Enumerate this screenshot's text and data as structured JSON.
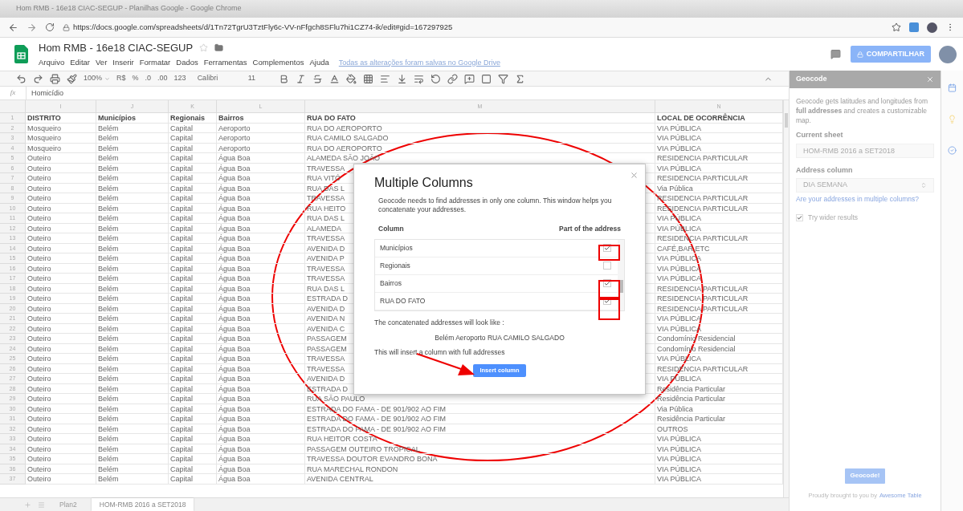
{
  "window": {
    "title": "Hom RMB - 16e18 CIAC-SEGUP - Planilhas Google - Google Chrome"
  },
  "browser": {
    "url": "https://docs.google.com/spreadsheets/d/1Tn72TgrU3TztFly6c-VV-nFfgch8SFlu7hi1CZ74-ik/edit#gid=167297925"
  },
  "document": {
    "title": "Hom RMB - 16e18 CIAC-SEGUP",
    "starred": false,
    "save_status": "Todas as alterações foram salvas no Google Drive",
    "share_button": "COMPARTILHAR"
  },
  "menu": [
    "Arquivo",
    "Editar",
    "Ver",
    "Inserir",
    "Formatar",
    "Dados",
    "Ferramentas",
    "Complementos",
    "Ajuda"
  ],
  "toolbar": {
    "zoom": "100%",
    "currency": "R$",
    "percent": "%",
    "decrease_decimals": ".0",
    "increase_decimals": ".00",
    "number_format": "123",
    "font": "Calibri",
    "font_size": "11"
  },
  "formula_bar": {
    "label": "fx",
    "value": "Homicídio"
  },
  "sheet": {
    "columns": [
      "I",
      "J",
      "K",
      "L",
      "M",
      "N"
    ],
    "header_row": {
      "number": "1",
      "cells": [
        "DISTRITO",
        "Municípios",
        "Regionais",
        "Bairros",
        "RUA DO FATO",
        "LOCAL DE OCORRÊNCIA"
      ]
    },
    "rows": [
      {
        "number": "2",
        "cells": [
          "Mosqueiro",
          "Belém",
          "Capital",
          "Aeroporto",
          "RUA DO AEROPORTO",
          "VIA PÚBLICA"
        ]
      },
      {
        "number": "3",
        "cells": [
          "Mosqueiro",
          "Belém",
          "Capital",
          "Aeroporto",
          "RUA CAMILO SALGADO",
          "VIA PÚBLICA"
        ]
      },
      {
        "number": "4",
        "cells": [
          "Mosqueiro",
          "Belém",
          "Capital",
          "Aeroporto",
          "RUA DO AEROPORTO",
          "VIA PÚBLICA"
        ]
      },
      {
        "number": "5",
        "cells": [
          "Outeiro",
          "Belém",
          "Capital",
          "Água Boa",
          "ALAMEDA SÃO JOÃO",
          "RESIDENCIA PARTICULAR"
        ]
      },
      {
        "number": "6",
        "cells": [
          "Outeiro",
          "Belém",
          "Capital",
          "Água Boa",
          "TRAVESSA",
          "VIA PÚBLICA"
        ]
      },
      {
        "number": "7",
        "cells": [
          "Outeiro",
          "Belém",
          "Capital",
          "Água Boa",
          "RUA VITÓ",
          "RESIDENCIA PARTICULAR"
        ]
      },
      {
        "number": "8",
        "cells": [
          "Outeiro",
          "Belém",
          "Capital",
          "Água Boa",
          "RUA DAS L",
          "Via Pública"
        ]
      },
      {
        "number": "9",
        "cells": [
          "Outeiro",
          "Belém",
          "Capital",
          "Água Boa",
          "TRAVESSA",
          "RESIDENCIA PARTICULAR"
        ]
      },
      {
        "number": "10",
        "cells": [
          "Outeiro",
          "Belém",
          "Capital",
          "Água Boa",
          "RUA HEITO",
          "RESIDENCIA PARTICULAR"
        ]
      },
      {
        "number": "11",
        "cells": [
          "Outeiro",
          "Belém",
          "Capital",
          "Água Boa",
          "RUA DAS L",
          "VIA PÚBLICA"
        ]
      },
      {
        "number": "12",
        "cells": [
          "Outeiro",
          "Belém",
          "Capital",
          "Água Boa",
          "ALAMEDA",
          "VIA PÚBLICA"
        ]
      },
      {
        "number": "13",
        "cells": [
          "Outeiro",
          "Belém",
          "Capital",
          "Água Boa",
          "TRAVESSA",
          "RESIDENCIA PARTICULAR"
        ]
      },
      {
        "number": "14",
        "cells": [
          "Outeiro",
          "Belém",
          "Capital",
          "Água Boa",
          "AVENIDA D",
          "CAFÉ,BAR,ETC"
        ]
      },
      {
        "number": "15",
        "cells": [
          "Outeiro",
          "Belém",
          "Capital",
          "Água Boa",
          "AVENIDA P",
          "VIA PÚBLICA"
        ]
      },
      {
        "number": "16",
        "cells": [
          "Outeiro",
          "Belém",
          "Capital",
          "Água Boa",
          "TRAVESSA",
          "VIA PÚBLICA"
        ]
      },
      {
        "number": "17",
        "cells": [
          "Outeiro",
          "Belém",
          "Capital",
          "Água Boa",
          "TRAVESSA",
          "VIA PÚBLICA"
        ]
      },
      {
        "number": "18",
        "cells": [
          "Outeiro",
          "Belém",
          "Capital",
          "Água Boa",
          "RUA DAS L",
          "RESIDENCIA PARTICULAR"
        ]
      },
      {
        "number": "19",
        "cells": [
          "Outeiro",
          "Belém",
          "Capital",
          "Água Boa",
          "ESTRADA D",
          "RESIDENCIA PARTICULAR"
        ]
      },
      {
        "number": "20",
        "cells": [
          "Outeiro",
          "Belém",
          "Capital",
          "Água Boa",
          "AVENIDA D",
          "RESIDENCIA PARTICULAR"
        ]
      },
      {
        "number": "21",
        "cells": [
          "Outeiro",
          "Belém",
          "Capital",
          "Água Boa",
          "AVENIDA N",
          "VIA PÚBLICA"
        ]
      },
      {
        "number": "22",
        "cells": [
          "Outeiro",
          "Belém",
          "Capital",
          "Água Boa",
          "AVENIDA C",
          "VIA PÚBLICA"
        ]
      },
      {
        "number": "23",
        "cells": [
          "Outeiro",
          "Belém",
          "Capital",
          "Água Boa",
          "PASSAGEM",
          "Condomínio Residencial"
        ]
      },
      {
        "number": "24",
        "cells": [
          "Outeiro",
          "Belém",
          "Capital",
          "Água Boa",
          "PASSAGEM",
          "Condomínio Residencial"
        ]
      },
      {
        "number": "25",
        "cells": [
          "Outeiro",
          "Belém",
          "Capital",
          "Água Boa",
          "TRAVESSA",
          "VIA PÚBLICA"
        ]
      },
      {
        "number": "26",
        "cells": [
          "Outeiro",
          "Belém",
          "Capital",
          "Água Boa",
          "TRAVESSA",
          "RESIDENCIA PARTICULAR"
        ]
      },
      {
        "number": "27",
        "cells": [
          "Outeiro",
          "Belém",
          "Capital",
          "Água Boa",
          "AVENIDA D",
          "VIA PÚBLICA"
        ]
      },
      {
        "number": "28",
        "cells": [
          "Outeiro",
          "Belém",
          "Capital",
          "Água Boa",
          "ESTRADA D",
          "Residência Particular"
        ]
      },
      {
        "number": "29",
        "cells": [
          "Outeiro",
          "Belém",
          "Capital",
          "Água Boa",
          "RUA SÃO PAULO",
          "Residência Particular"
        ]
      },
      {
        "number": "30",
        "cells": [
          "Outeiro",
          "Belém",
          "Capital",
          "Água Boa",
          "ESTRADA DO FAMA - DE 901/902 AO FIM",
          "Via Pública"
        ]
      },
      {
        "number": "31",
        "cells": [
          "Outeiro",
          "Belém",
          "Capital",
          "Água Boa",
          "ESTRADA DO FAMA - DE 901/902 AO FIM",
          "Residência Particular"
        ]
      },
      {
        "number": "32",
        "cells": [
          "Outeiro",
          "Belém",
          "Capital",
          "Água Boa",
          "ESTRADA DO FAMA - DE 901/902 AO FIM",
          "OUTROS"
        ]
      },
      {
        "number": "33",
        "cells": [
          "Outeiro",
          "Belém",
          "Capital",
          "Água Boa",
          "RUA HEITOR COSTA",
          "VIA PÚBLICA"
        ]
      },
      {
        "number": "34",
        "cells": [
          "Outeiro",
          "Belém",
          "Capital",
          "Água Boa",
          "PASSAGEM OUTEIRO TROPICAL",
          "VIA PÚBLICA"
        ]
      },
      {
        "number": "35",
        "cells": [
          "Outeiro",
          "Belém",
          "Capital",
          "Água Boa",
          "TRAVESSA DOUTOR EVANDRO BONA",
          "VIA PÚBLICA"
        ]
      },
      {
        "number": "36",
        "cells": [
          "Outeiro",
          "Belém",
          "Capital",
          "Água Boa",
          "RUA MARECHAL RONDON",
          "VIA PÚBLICA"
        ]
      },
      {
        "number": "37",
        "cells": [
          "Outeiro",
          "Belém",
          "Capital",
          "Água Boa",
          "AVENIDA CENTRAL",
          "VIA PÚBLICA"
        ]
      }
    ]
  },
  "sheet_tabs": [
    {
      "label": "Plan2",
      "selected": false
    },
    {
      "label": "HOM-RMB 2016 a SET2018",
      "selected": true
    }
  ],
  "dialog": {
    "title": "Multiple Columns",
    "description": "Geocode needs to find addresses in only one column. This window helps you concatenate your addresses.",
    "column_header": "Column",
    "part_header": "Part of the address",
    "columns": [
      {
        "label": "Municípios",
        "checked": true
      },
      {
        "label": "Regionais",
        "checked": false
      },
      {
        "label": "Bairros",
        "checked": true
      },
      {
        "label": "RUA DO FATO",
        "checked": true
      }
    ],
    "preview_label": "The concatenated addresses will look like :",
    "preview": "Belém Aeroporto RUA CAMILO SALGADO",
    "note": "This will insert a column with full addresses",
    "button": "Insert column"
  },
  "sidebar": {
    "title": "Geocode",
    "description": "Geocode gets latitudes and longitudes from **full addresses** and creates a customizable map.",
    "current_sheet_label": "Current sheet",
    "current_sheet": "HOM-RMB 2016 a SET2018",
    "address_column_label": "Address column",
    "address_column": "DIA SEMANA",
    "multiple_columns_link": "Are your addresses in multiple columns?",
    "wider_results": {
      "label": "Try wider results",
      "checked": true
    },
    "button": "Geocode!",
    "footer": "Proudly brought to you by",
    "footer_link": "Awesome Table"
  }
}
